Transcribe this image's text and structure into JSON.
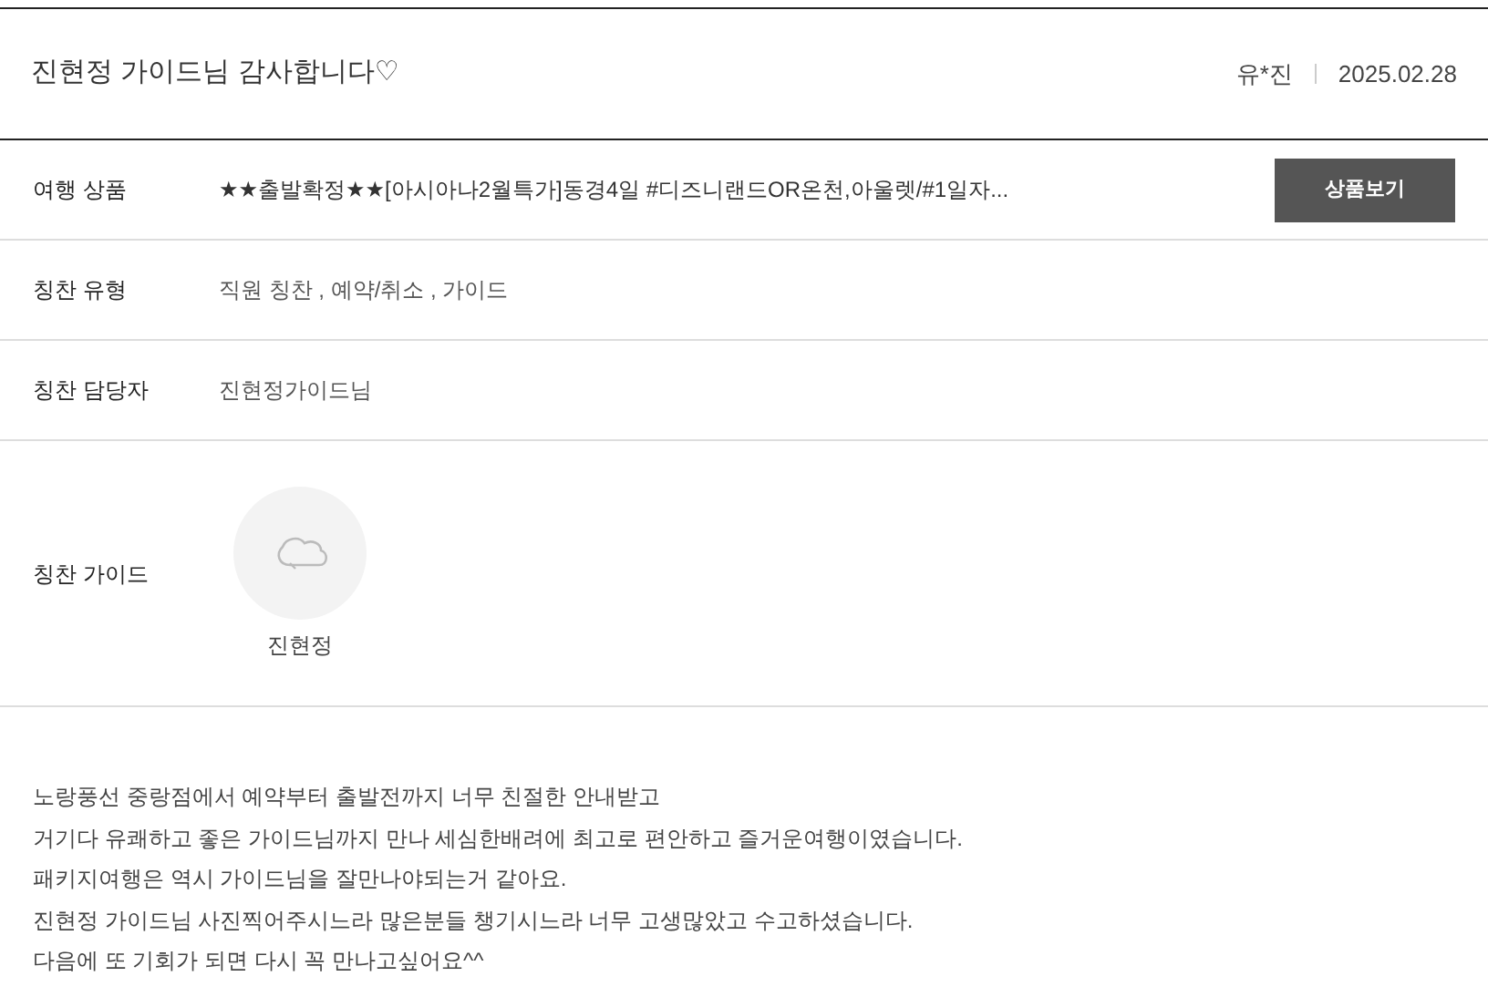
{
  "review": {
    "title": "진현정 가이드님 감사합니다♡",
    "author": "유*진",
    "date": "2025.02.28"
  },
  "rows": [
    {
      "kind": "product",
      "label": "여행 상품",
      "value": "★★출발확정★★[아시아나2월특가]동경4일 #디즈니랜드OR온천,아울렛/#1일자...",
      "button": "상품보기"
    },
    {
      "kind": "text",
      "label": "칭찬 유형",
      "value": "직원 칭찬 , 예약/취소 , 가이드"
    },
    {
      "kind": "text",
      "label": "칭찬 담당자",
      "value": "진현정가이드님"
    },
    {
      "kind": "guide",
      "label": "칭찬 가이드",
      "guide_name": "진현정"
    }
  ],
  "body": [
    "노랑풍선 중랑점에서 예약부터 출발전까지 너무 친절한 안내받고",
    "거기다 유쾌하고 좋은 가이드님까지 만나 세심한배려에 최고로 편안하고 즐거운여행이였습니다.",
    "패키지여행은 역시 가이드님을 잘만나야되는거 같아요.",
    "진현정 가이드님 사진찍어주시느라 많은분들 챙기시느라 너무 고생많았고 수고하셨습니다.",
    "다음에 또 기회가 되면 다시 꼭 만나고싶어요^^"
  ]
}
